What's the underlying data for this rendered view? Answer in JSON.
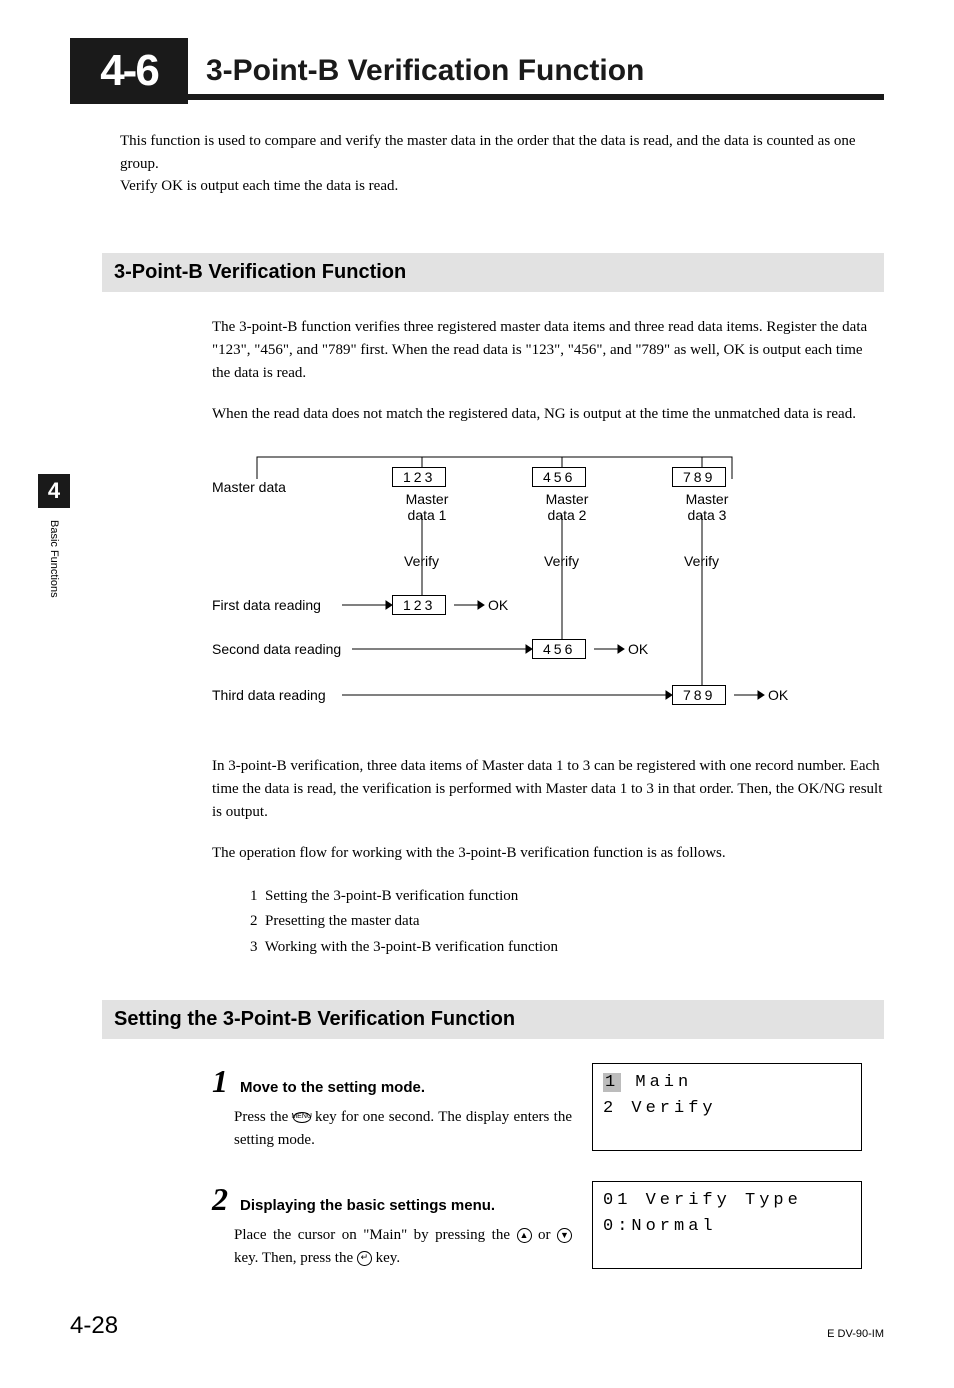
{
  "header": {
    "section_number": "4-6",
    "title": "3-Point-B Verification Function"
  },
  "intro": {
    "line1": "This function is used to compare and verify the master data in the order that the data is read, and the data is counted as one group.",
    "line2": "Verify OK is output each time the data is read."
  },
  "subsection1": {
    "title": "3-Point-B Verification Function",
    "para1": "The 3-point-B function verifies three registered master data items and three read data items. Register the data \"123\", \"456\", and \"789\" first. When the read data is \"123\", \"456\", and \"789\" as well, OK is output each time the data is read.",
    "para2": "When the read data does not match the registered data, NG is output at the time the unmatched data is read."
  },
  "diagram": {
    "row_master_label": "Master data",
    "masters": [
      {
        "value": "123",
        "label": "Master data 1"
      },
      {
        "value": "456",
        "label": "Master data 2"
      },
      {
        "value": "789",
        "label": "Master data 3"
      }
    ],
    "verify_label": "Verify",
    "readings": [
      {
        "label": "First data reading",
        "value": "123",
        "result": "OK"
      },
      {
        "label": "Second data reading",
        "value": "456",
        "result": "OK"
      },
      {
        "label": "Third data reading",
        "value": "789",
        "result": "OK"
      }
    ]
  },
  "explain": {
    "para1": "In 3-point-B verification, three data items of Master data 1 to 3 can be registered with one record number. Each time the data is read, the verification is performed with Master data 1 to 3 in that order. Then, the OK/NG result is output.",
    "para2": "The operation flow for working with the 3-point-B verification function is as follows."
  },
  "flow_list": [
    {
      "n": "1",
      "text": "Setting the 3-point-B verification function"
    },
    {
      "n": "2",
      "text": "Presetting the master data"
    },
    {
      "n": "3",
      "text": "Working with the 3-point-B verification function"
    }
  ],
  "subsection2": {
    "title": "Setting the 3-Point-B Verification Function"
  },
  "steps": [
    {
      "n": "1",
      "title": "Move to the setting mode.",
      "body_pre": "Press the ",
      "key": "MENU",
      "body_post": " key for one second. The display enters the setting mode.",
      "lcd": {
        "line1_hl": "1",
        "line1_rest": " Main",
        "line2": "2 Verify"
      }
    },
    {
      "n": "2",
      "title": "Displaying the basic settings menu.",
      "body_pre": "Place the cursor on \"Main\" by pressing the ",
      "body_mid1": " or ",
      "body_mid2": " key. Then, press the ",
      "body_end": " key.",
      "lcd": {
        "line1": "01 Verify Type",
        "line2": "0:Normal"
      }
    }
  ],
  "sidetab": {
    "number": "4",
    "label": "Basic Functions"
  },
  "footer": {
    "page": "4-28",
    "doc": "E DV-90-IM"
  }
}
